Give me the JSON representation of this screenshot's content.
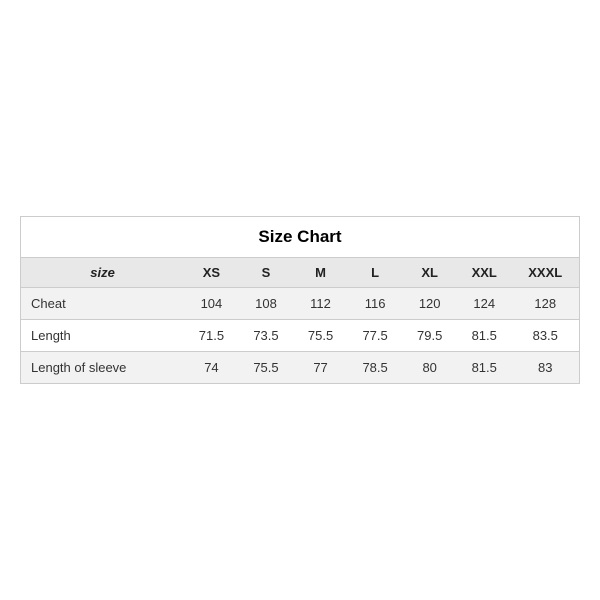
{
  "table": {
    "title": "Size Chart",
    "headers": [
      "size",
      "XS",
      "S",
      "M",
      "L",
      "XL",
      "XXL",
      "XXXL"
    ],
    "rows": [
      {
        "label": "Cheat",
        "values": [
          "104",
          "108",
          "112",
          "116",
          "120",
          "124",
          "128"
        ],
        "shaded": true
      },
      {
        "label": "Length",
        "values": [
          "71.5",
          "73.5",
          "75.5",
          "77.5",
          "79.5",
          "81.5",
          "83.5"
        ],
        "shaded": false
      },
      {
        "label": "Length of sleeve",
        "values": [
          "74",
          "75.5",
          "77",
          "78.5",
          "80",
          "81.5",
          "83"
        ],
        "shaded": true
      }
    ]
  }
}
